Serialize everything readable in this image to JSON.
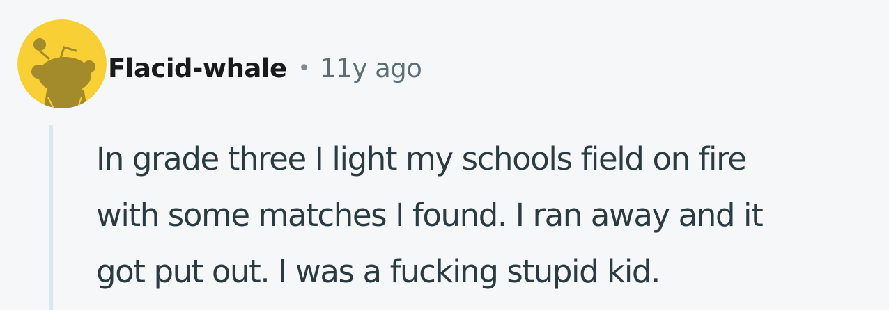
{
  "comment": {
    "author": "Flacid-whale",
    "separator": "•",
    "timestamp": "11y ago",
    "avatar_icon": "snoo-avatar-icon",
    "body_lines": [
      "In grade three I light my schools field on fire",
      "with some matches I found. I ran away and it",
      "got put out. I was a fucking stupid kid."
    ]
  },
  "colors": {
    "background": "#f6f7f8",
    "avatar_background": "#f8cf35",
    "avatar_figure": "#a38a2b",
    "username": "#1a1a1b",
    "meta": "#5d7079",
    "body": "#2a3c42",
    "thread_line": "#dbe6ee"
  }
}
